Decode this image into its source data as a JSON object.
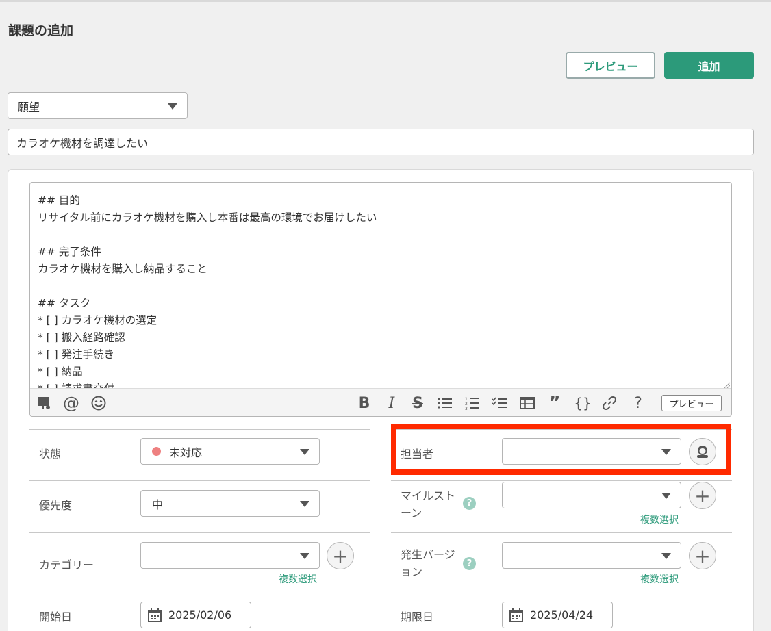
{
  "page": {
    "title": "課題の追加"
  },
  "actions": {
    "preview_label": "プレビュー",
    "add_label": "追加"
  },
  "issue_type": {
    "value": "願望"
  },
  "summary": {
    "value": "カラオケ機材を調達したい"
  },
  "description": {
    "text": "## 目的\nリサイタル前にカラオケ機材を購入し本番は最高の環境でお届けしたい\n\n## 完了条件\nカラオケ機材を購入し納品すること\n\n## タスク\n* [ ] カラオケ機材の選定\n* [ ] 搬入経路確認\n* [ ] 発注手続き\n* [ ] 納品\n* [ ] 請求書交付"
  },
  "toolbar": {
    "preview_label": "プレビュー",
    "icons": [
      "attach-icon",
      "mention-icon",
      "emoji-icon",
      "bold-icon",
      "italic-icon",
      "strikethrough-icon",
      "bullet-list-icon",
      "numbered-list-icon",
      "checklist-icon",
      "table-icon",
      "quote-icon",
      "code-icon",
      "link-icon",
      "help-icon"
    ]
  },
  "fields": {
    "status": {
      "label": "状態",
      "value": "未対応",
      "color": "#ee8080"
    },
    "priority": {
      "label": "優先度",
      "value": "中"
    },
    "category": {
      "label": "カテゴリー",
      "value": "",
      "multi_label": "複数選択"
    },
    "start_date": {
      "label": "開始日",
      "value": "2025/02/06"
    },
    "assignee": {
      "label": "担当者",
      "value": ""
    },
    "milestone": {
      "label": "マイルストーン",
      "value": "",
      "multi_label": "複数選択"
    },
    "version": {
      "label": "発生バージョン",
      "value": "",
      "multi_label": "複数選択"
    },
    "due_date": {
      "label": "期限日",
      "value": "2025/04/24"
    }
  },
  "colors": {
    "accent": "#2c9a7a",
    "highlight": "#ff2a00"
  }
}
